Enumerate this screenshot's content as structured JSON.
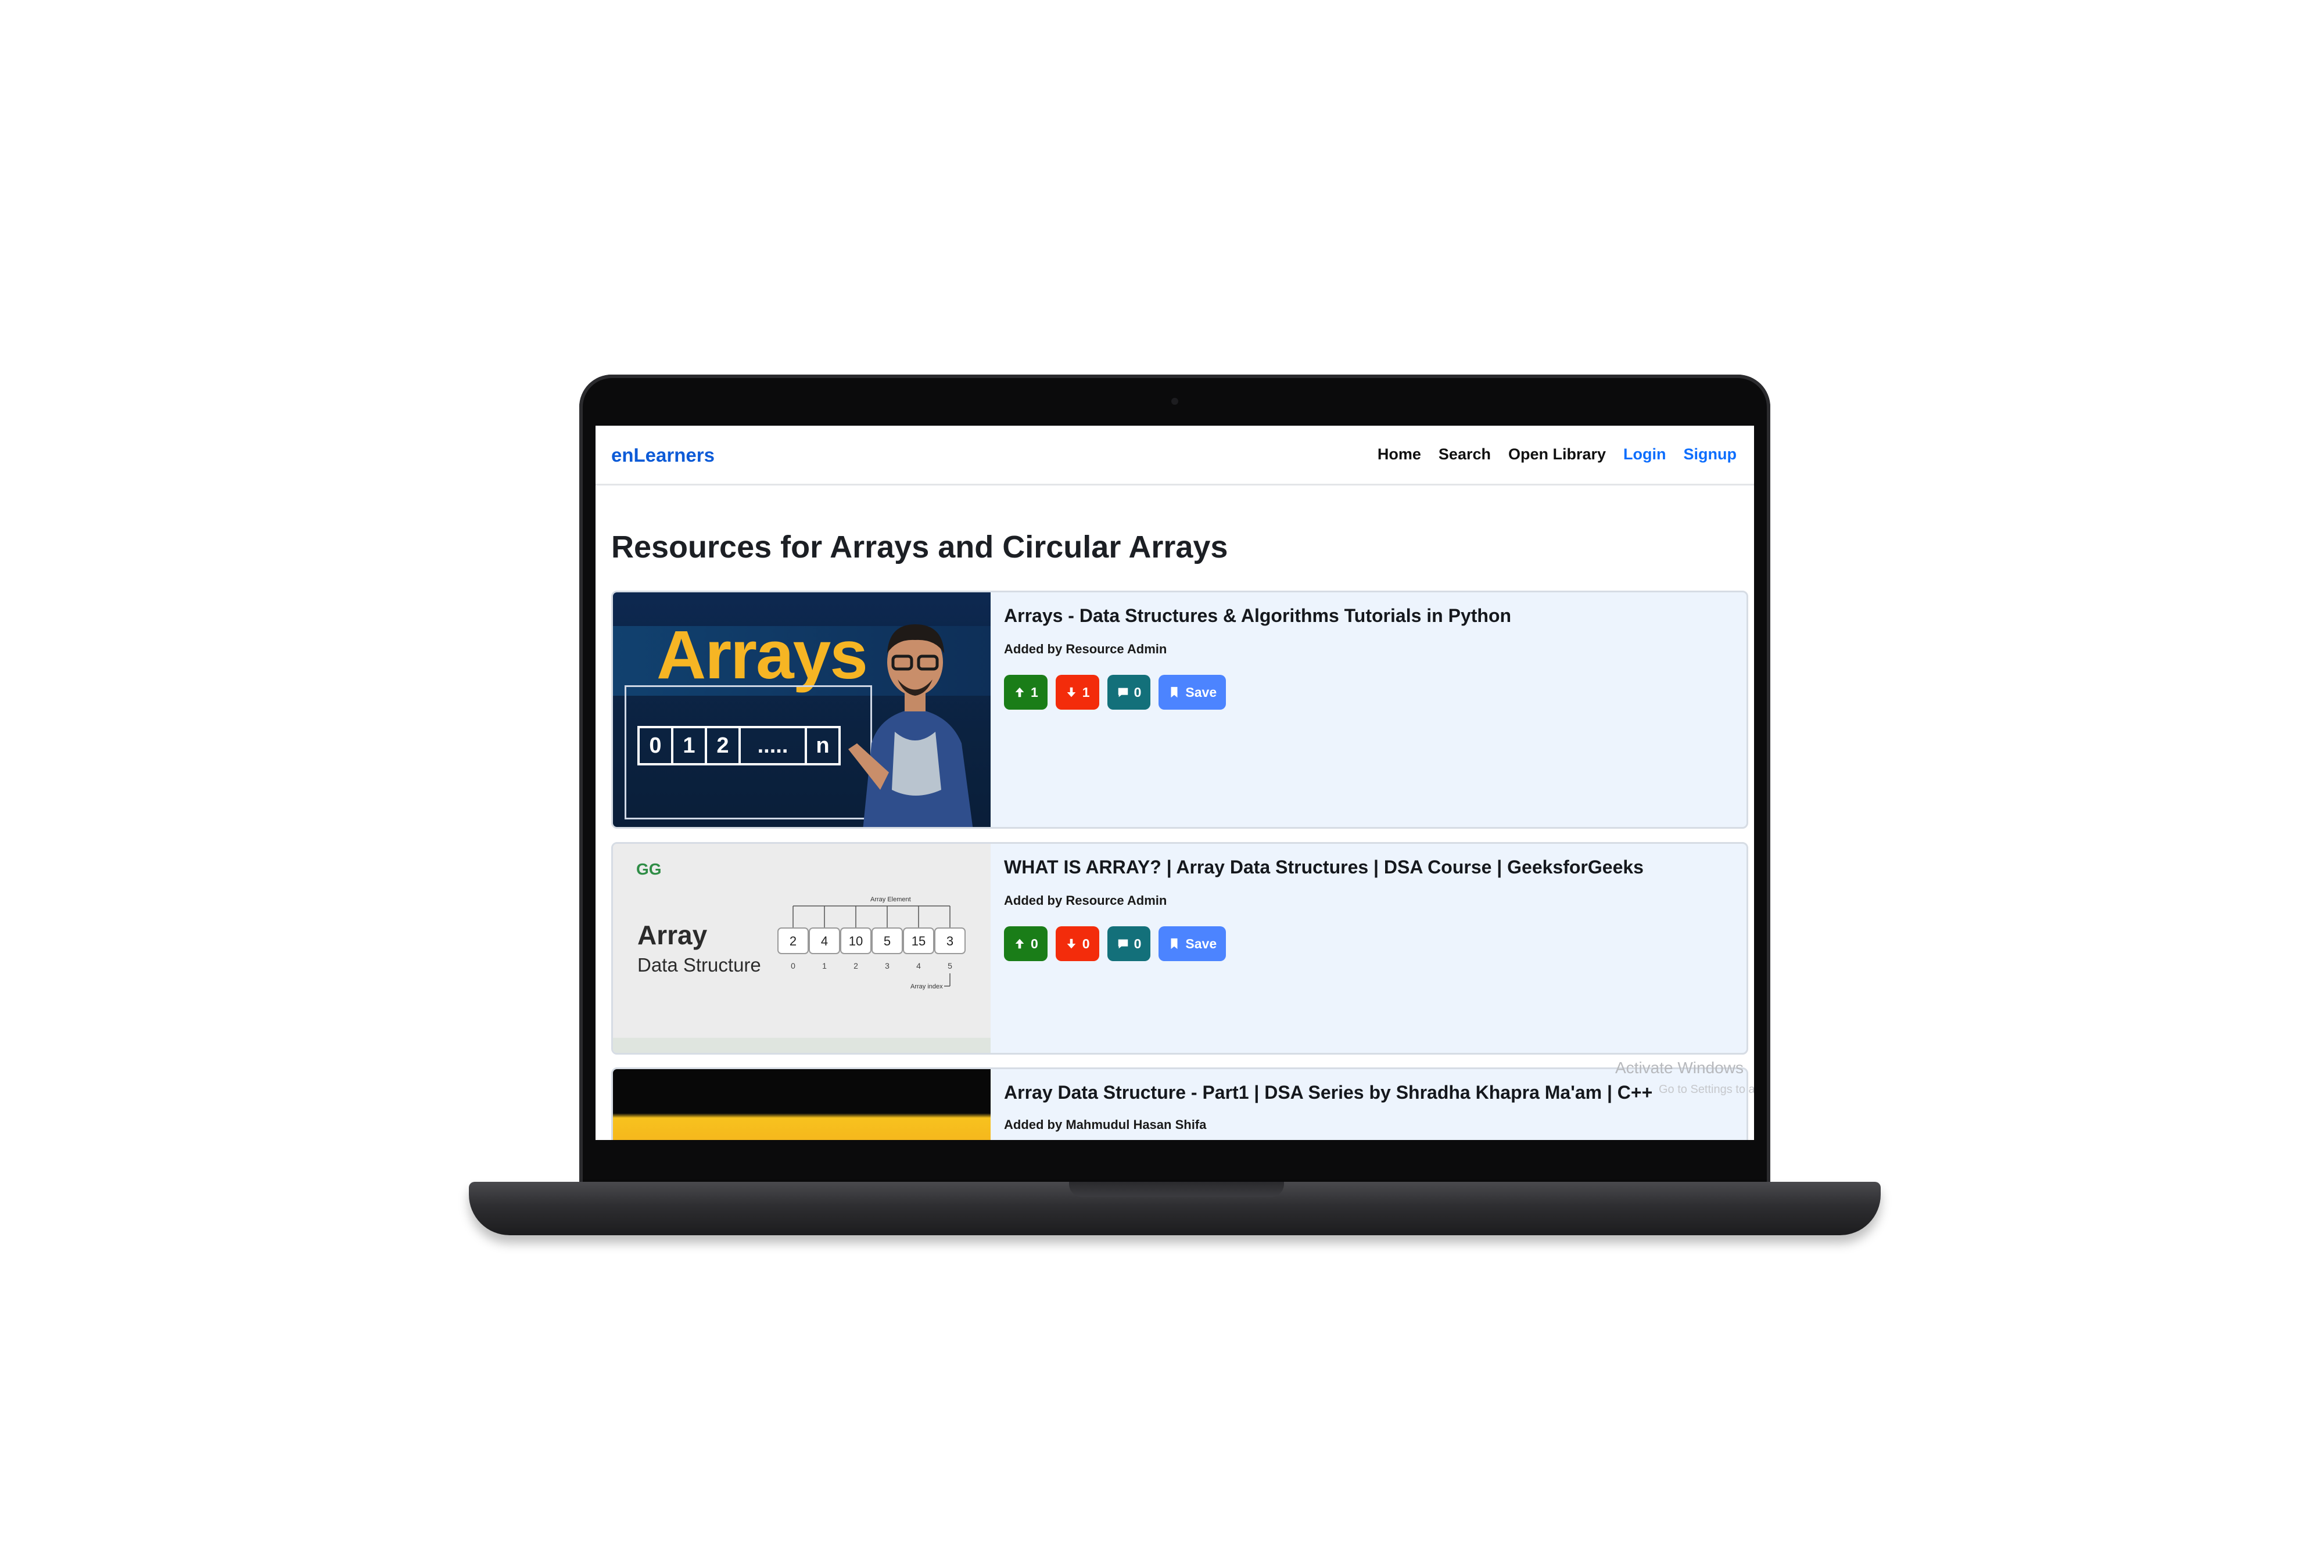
{
  "navbar": {
    "brand": "enLearners",
    "links": [
      "Home",
      "Search",
      "Open Library",
      "Login",
      "Signup"
    ]
  },
  "page": {
    "title": "Resources for Arrays and Circular Arrays"
  },
  "resources": [
    {
      "title": "Arrays - Data Structures & Algorithms Tutorials in Python",
      "author": "Added by Resource Admin",
      "upvotes": "1",
      "downvotes": "1",
      "comments": "0",
      "save_label": "Save",
      "thumbnail": {
        "heading": "Arrays",
        "cells": [
          "0",
          "1",
          "2",
          ".....",
          "n"
        ]
      }
    },
    {
      "title": "WHAT IS ARRAY? | Array Data Structures | DSA Course | GeeksforGeeks",
      "author": "Added by Resource Admin",
      "upvotes": "0",
      "downvotes": "0",
      "comments": "0",
      "save_label": "Save",
      "thumbnail": {
        "logo": "GG",
        "heading": "Array",
        "subheading": "Data Structure",
        "caption_top": "Array Element",
        "caption_bottom": "Array index",
        "values": [
          "2",
          "4",
          "10",
          "5",
          "15",
          "3"
        ],
        "indices": [
          "0",
          "1",
          "2",
          "3",
          "4",
          "5"
        ]
      }
    },
    {
      "title": "Array Data Structure - Part1 | DSA Series by Shradha Khapra Ma'am | C++",
      "author": "Added by Mahmudul Hasan Shifa"
    }
  ],
  "watermark": {
    "line1": "Activate Windows",
    "line2": "Go to Settings to activate Windows."
  },
  "colors": {
    "brand": "#0d5bd7",
    "upvote": "#1a7d18",
    "downvote": "#f32c0b",
    "comment": "#13707a",
    "save": "#4c84ff",
    "card_bg": "#edf4fd"
  }
}
